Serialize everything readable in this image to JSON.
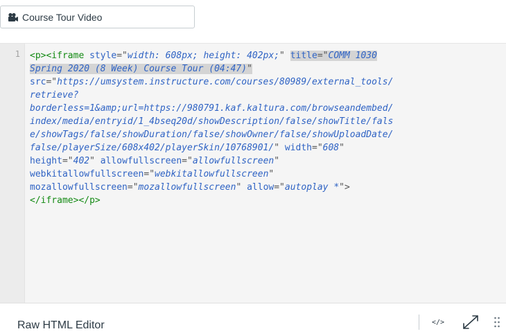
{
  "link": {
    "label": "Course Tour Video",
    "icon": "video-camera-icon"
  },
  "editor": {
    "line_number": "1",
    "lines": [
      [
        [
          "tg",
          "<p><iframe "
        ],
        [
          "at",
          "style"
        ],
        [
          "pl",
          "=\""
        ],
        [
          "st",
          "width: 608px; height: 402px;"
        ],
        [
          "pl",
          "\" "
        ],
        [
          "at",
          "title",
          "hl"
        ],
        [
          "pl",
          "=\"",
          "hl"
        ],
        [
          "st",
          "COMM 1030",
          "hl"
        ]
      ],
      [
        [
          "st",
          "Spring 2020 (8 Week) Course Tour (04:47)",
          "hl"
        ],
        [
          "pl",
          "\"",
          "hl"
        ]
      ],
      [
        [
          "at",
          "src"
        ],
        [
          "pl",
          "=\""
        ],
        [
          "st",
          "https://umsystem.instructure.com/courses/80989/external_tools/"
        ]
      ],
      [
        [
          "st",
          "retrieve?"
        ]
      ],
      [
        [
          "st",
          "borderless=1&amp;url=https://980791.kaf.kaltura.com/browseandembed/"
        ]
      ],
      [
        [
          "st",
          "index/media/entryid/1_4bseq20d/showDescription/false/showTitle/fals"
        ]
      ],
      [
        [
          "st",
          "e/showTags/false/showDuration/false/showOwner/false/showUploadDate/"
        ]
      ],
      [
        [
          "st",
          "false/playerSize/608x402/playerSkin/10768901/"
        ],
        [
          "pl",
          "\" "
        ],
        [
          "at",
          "width"
        ],
        [
          "pl",
          "=\""
        ],
        [
          "st",
          "608"
        ],
        [
          "pl",
          "\""
        ]
      ],
      [
        [
          "at",
          "height"
        ],
        [
          "pl",
          "=\""
        ],
        [
          "st",
          "402"
        ],
        [
          "pl",
          "\" "
        ],
        [
          "at",
          "allowfullscreen"
        ],
        [
          "pl",
          "=\""
        ],
        [
          "st",
          "allowfullscreen"
        ],
        [
          "pl",
          "\""
        ]
      ],
      [
        [
          "at",
          "webkitallowfullscreen"
        ],
        [
          "pl",
          "=\""
        ],
        [
          "st",
          "webkitallowfullscreen"
        ],
        [
          "pl",
          "\""
        ]
      ],
      [
        [
          "at",
          "mozallowfullscreen"
        ],
        [
          "pl",
          "=\""
        ],
        [
          "st",
          "mozallowfullscreen"
        ],
        [
          "pl",
          "\" "
        ],
        [
          "at",
          "allow"
        ],
        [
          "pl",
          "=\""
        ],
        [
          "st",
          "autoplay *"
        ],
        [
          "pl",
          "\">"
        ]
      ],
      [
        [
          "tg",
          "</iframe></p>"
        ]
      ]
    ]
  },
  "footer": {
    "label": "Raw HTML Editor",
    "html_toggle_label": "</>",
    "html_toggle_icon": "code-icon",
    "fullscreen_icon": "expand-icon",
    "resize_icon": "drag-handle-icon"
  },
  "colors": {
    "tag": "#148a14",
    "attribute": "#2f63c4",
    "selection": "#d4d4d4"
  }
}
